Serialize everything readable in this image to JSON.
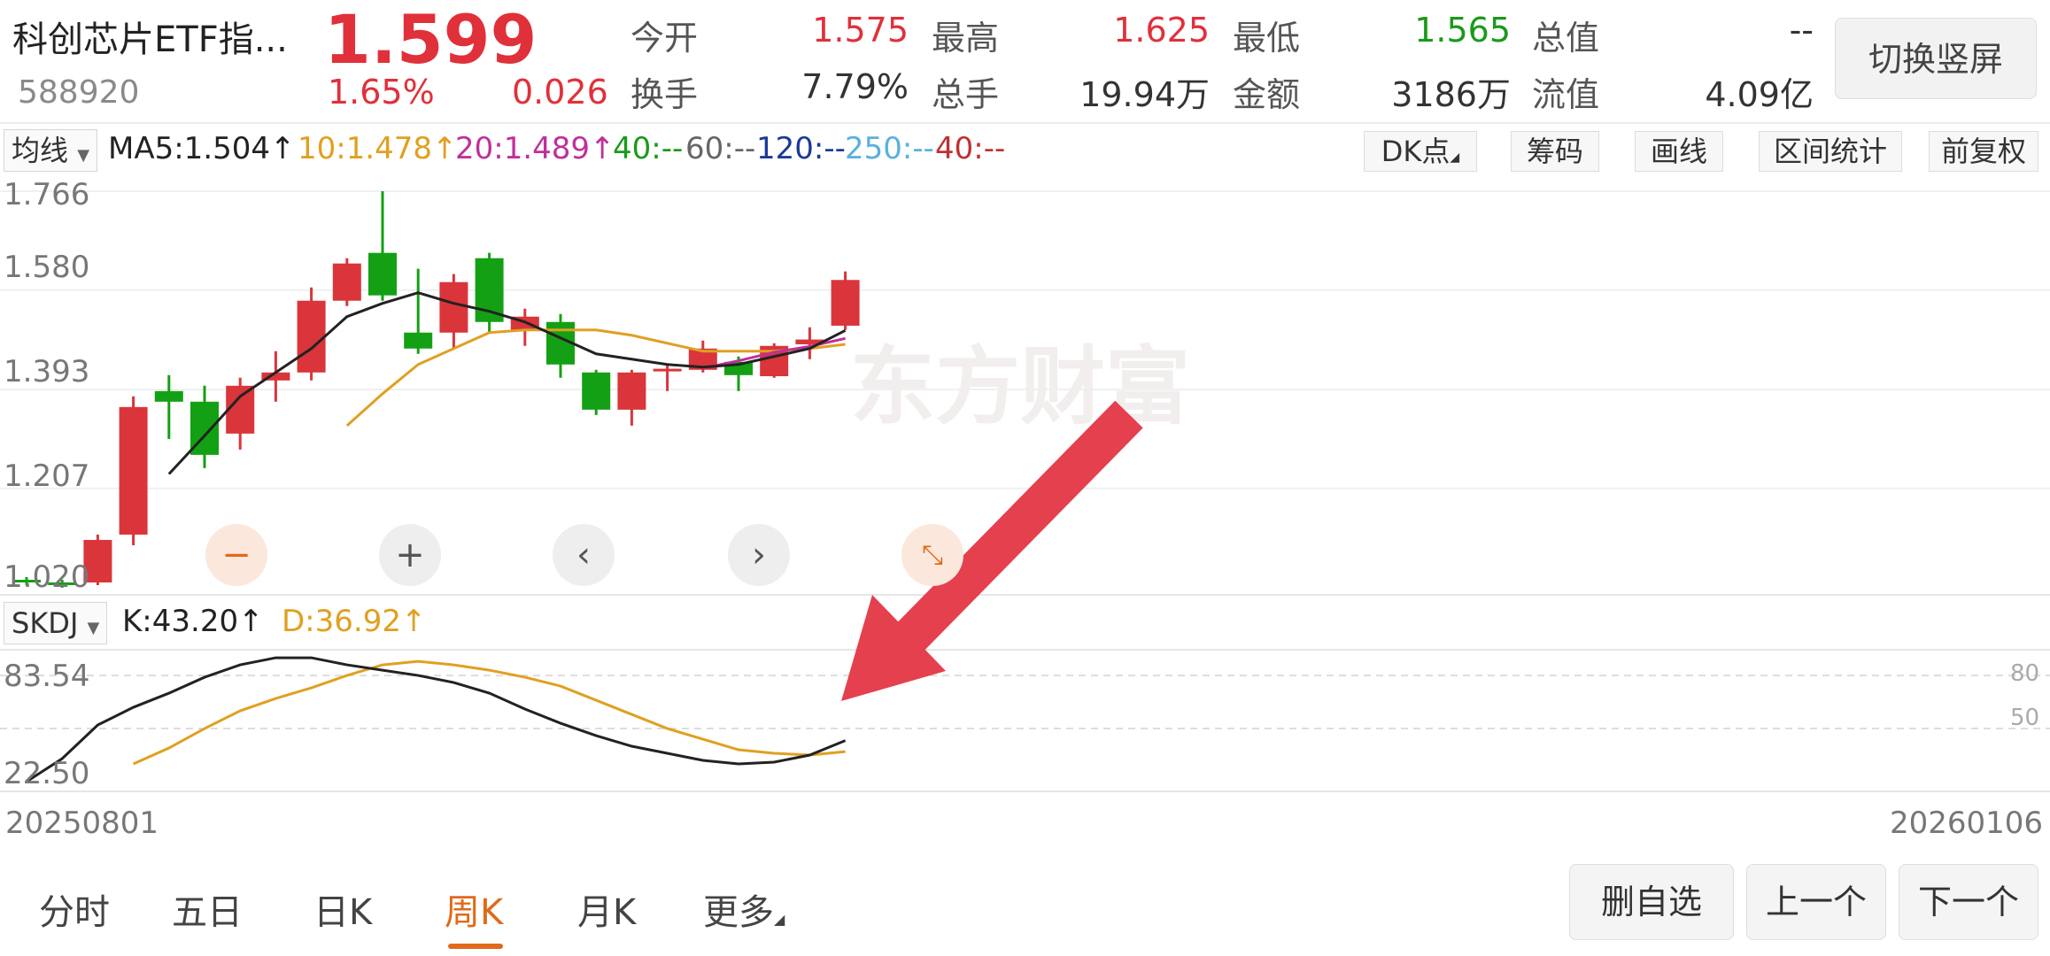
{
  "header": {
    "name": "科创芯片ETF指...",
    "code": "588920",
    "price": "1.599",
    "change_pct": "1.65%",
    "change_amt": "0.026",
    "stats": [
      {
        "label": "今开",
        "value": "1.575",
        "color": "#e0303a"
      },
      {
        "label": "最高",
        "value": "1.625",
        "color": "#e0303a"
      },
      {
        "label": "最低",
        "value": "1.565",
        "color": "#1a9a1a"
      },
      {
        "label": "总值",
        "value": "--",
        "color": "#333333"
      },
      {
        "label": "换手",
        "value": "7.79%",
        "color": "#333333"
      },
      {
        "label": "总手",
        "value": "19.94万",
        "color": "#333333"
      },
      {
        "label": "金额",
        "value": "3186万",
        "color": "#333333"
      },
      {
        "label": "流值",
        "value": "4.09亿",
        "color": "#333333"
      }
    ],
    "switch_label": "切换竖屏"
  },
  "ma_bar": {
    "selector": "均线",
    "items": [
      {
        "text": "MA5:1.504↑",
        "color": "#222222"
      },
      {
        "text": "10:1.478↑",
        "color": "#e0a020"
      },
      {
        "text": "20:1.489↑",
        "color": "#c0309a"
      },
      {
        "text": "40:--",
        "color": "#1a9a1a"
      },
      {
        "text": "60:--",
        "color": "#666666"
      },
      {
        "text": "120:--",
        "color": "#1a3a9a"
      },
      {
        "text": "250:--",
        "color": "#5ab0e0"
      },
      {
        "text": "40:--",
        "color": "#c03030"
      }
    ],
    "tools": [
      "DK点",
      "筹码",
      "画线",
      "区间统计",
      "前复权"
    ]
  },
  "main_chart": {
    "y_labels": [
      "1.766",
      "1.580",
      "1.393",
      "1.207",
      "1.020"
    ],
    "watermark": "东方财富",
    "colors": {
      "up": "#d9353a",
      "down": "#14a014",
      "ma5": "#222222",
      "ma10": "#e0a020",
      "ma20": "#c0309a"
    }
  },
  "chart_data": {
    "type": "candlestick",
    "ylim": [
      1.02,
      1.766
    ],
    "candles": [
      {
        "o": 1.035,
        "h": 1.04,
        "l": 1.025,
        "c": 1.03
      },
      {
        "o": 1.03,
        "h": 1.035,
        "l": 1.02,
        "c": 1.025
      },
      {
        "o": 1.03,
        "h": 1.12,
        "l": 1.025,
        "c": 1.11
      },
      {
        "o": 1.12,
        "h": 1.38,
        "l": 1.1,
        "c": 1.36
      },
      {
        "o": 1.39,
        "h": 1.42,
        "l": 1.3,
        "c": 1.37
      },
      {
        "o": 1.37,
        "h": 1.4,
        "l": 1.245,
        "c": 1.27
      },
      {
        "o": 1.31,
        "h": 1.415,
        "l": 1.28,
        "c": 1.4
      },
      {
        "o": 1.41,
        "h": 1.465,
        "l": 1.37,
        "c": 1.425
      },
      {
        "o": 1.425,
        "h": 1.585,
        "l": 1.41,
        "c": 1.56
      },
      {
        "o": 1.56,
        "h": 1.64,
        "l": 1.55,
        "c": 1.63
      },
      {
        "o": 1.65,
        "h": 1.766,
        "l": 1.56,
        "c": 1.57
      },
      {
        "o": 1.5,
        "h": 1.62,
        "l": 1.46,
        "c": 1.47
      },
      {
        "o": 1.5,
        "h": 1.61,
        "l": 1.47,
        "c": 1.595
      },
      {
        "o": 1.64,
        "h": 1.65,
        "l": 1.5,
        "c": 1.52
      },
      {
        "o": 1.505,
        "h": 1.545,
        "l": 1.475,
        "c": 1.53
      },
      {
        "o": 1.52,
        "h": 1.535,
        "l": 1.415,
        "c": 1.44
      },
      {
        "o": 1.425,
        "h": 1.43,
        "l": 1.345,
        "c": 1.355
      },
      {
        "o": 1.355,
        "h": 1.43,
        "l": 1.325,
        "c": 1.425
      },
      {
        "o": 1.43,
        "h": 1.44,
        "l": 1.39,
        "c": 1.432
      },
      {
        "o": 1.43,
        "h": 1.485,
        "l": 1.425,
        "c": 1.47
      },
      {
        "o": 1.445,
        "h": 1.455,
        "l": 1.39,
        "c": 1.42
      },
      {
        "o": 1.418,
        "h": 1.48,
        "l": 1.415,
        "c": 1.475
      },
      {
        "o": 1.478,
        "h": 1.51,
        "l": 1.45,
        "c": 1.487
      },
      {
        "o": 1.513,
        "h": 1.615,
        "l": 1.505,
        "c": 1.599
      }
    ],
    "ma5": [
      null,
      null,
      null,
      null,
      1.234,
      1.306,
      1.38,
      1.425,
      1.47,
      1.53,
      1.555,
      1.575,
      1.555,
      1.54,
      1.52,
      1.49,
      1.46,
      1.45,
      1.44,
      1.435,
      1.44,
      1.455,
      1.47,
      1.504
    ],
    "ma10": [
      null,
      null,
      null,
      null,
      null,
      null,
      null,
      null,
      null,
      1.325,
      1.385,
      1.44,
      1.47,
      1.5,
      1.505,
      1.505,
      1.505,
      1.495,
      1.48,
      1.465,
      1.465,
      1.465,
      1.47,
      1.478
    ],
    "ma20": [
      null,
      null,
      null,
      null,
      null,
      null,
      null,
      null,
      null,
      null,
      null,
      null,
      null,
      null,
      null,
      null,
      null,
      null,
      null,
      1.433,
      1.447,
      1.463,
      1.474,
      1.489
    ]
  },
  "kdj_bar": {
    "selector": "SKDJ",
    "k_text": "K:43.20↑",
    "d_text": "D:36.92↑",
    "k_color": "#222222",
    "d_color": "#e0a020"
  },
  "kdj_chart": {
    "y_labels": [
      "83.54",
      "22.50"
    ],
    "ref_labels": [
      "80",
      "50"
    ],
    "ylim": [
      22.5,
      83.54
    ],
    "k": [
      20,
      33,
      52,
      62,
      70,
      79,
      86,
      90,
      90,
      86,
      83,
      80,
      76,
      70,
      61,
      53,
      46,
      40,
      36,
      32,
      30,
      31,
      35,
      43.2
    ],
    "d": [
      null,
      null,
      null,
      30,
      39,
      50,
      60,
      67,
      73,
      80,
      86,
      88,
      86,
      83,
      79,
      74,
      66,
      58,
      50,
      44,
      38,
      36,
      35,
      36.92
    ]
  },
  "dates": {
    "start": "20250801",
    "end": "20260106"
  },
  "nav": {
    "zoom_out": "−",
    "zoom_in": "+",
    "left": "‹",
    "right": "›"
  },
  "tabs": [
    {
      "label": "分时",
      "active": false
    },
    {
      "label": "五日",
      "active": false
    },
    {
      "label": "日K",
      "active": false
    },
    {
      "label": "周K",
      "active": true
    },
    {
      "label": "月K",
      "active": false
    },
    {
      "label": "更多",
      "active": false
    }
  ],
  "buttons": {
    "delete_fav": "删自选",
    "prev": "上一个",
    "next": "下一个"
  }
}
